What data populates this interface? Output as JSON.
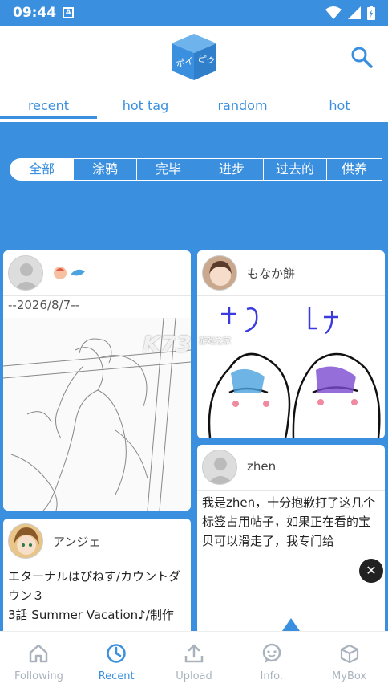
{
  "status": {
    "time": "09:44",
    "app_badge": "A"
  },
  "header": {
    "logo_text": "ポイピク"
  },
  "tabs": [
    {
      "label": "recent",
      "active": true
    },
    {
      "label": "hot tag",
      "active": false
    },
    {
      "label": "random",
      "active": false
    },
    {
      "label": "hot",
      "active": false
    }
  ],
  "categories": [
    "全部",
    "涂鸦",
    "完毕",
    "进步",
    "过去的",
    "供养"
  ],
  "posts": {
    "p1": {
      "caption": "--2026/8/7--"
    },
    "p2": {
      "username": "もなか餅"
    },
    "p3": {
      "username": "zhen",
      "text": "我是zhen，十分抱歉打了这几个标签占用帖子，如果正在看的宝贝可以滑走了，我专门给"
    },
    "p4": {
      "username": "アンジェ",
      "text": "エターナルはぴねす/カウントダウン３\n3話 Summer Vacation♪/制作"
    }
  },
  "watermark": {
    "main": "K73",
    "sub": "游戏之家"
  },
  "bottom_nav": [
    {
      "label": "Following",
      "icon": "home-icon",
      "active": false
    },
    {
      "label": "Recent",
      "icon": "clock-icon",
      "active": true
    },
    {
      "label": "Upload",
      "icon": "upload-icon",
      "active": false
    },
    {
      "label": "Info.",
      "icon": "chat-icon",
      "active": false
    },
    {
      "label": "MyBox",
      "icon": "box-icon",
      "active": false
    }
  ],
  "colors": {
    "primary": "#3a8fde",
    "nav_inactive": "#aab3bd"
  }
}
